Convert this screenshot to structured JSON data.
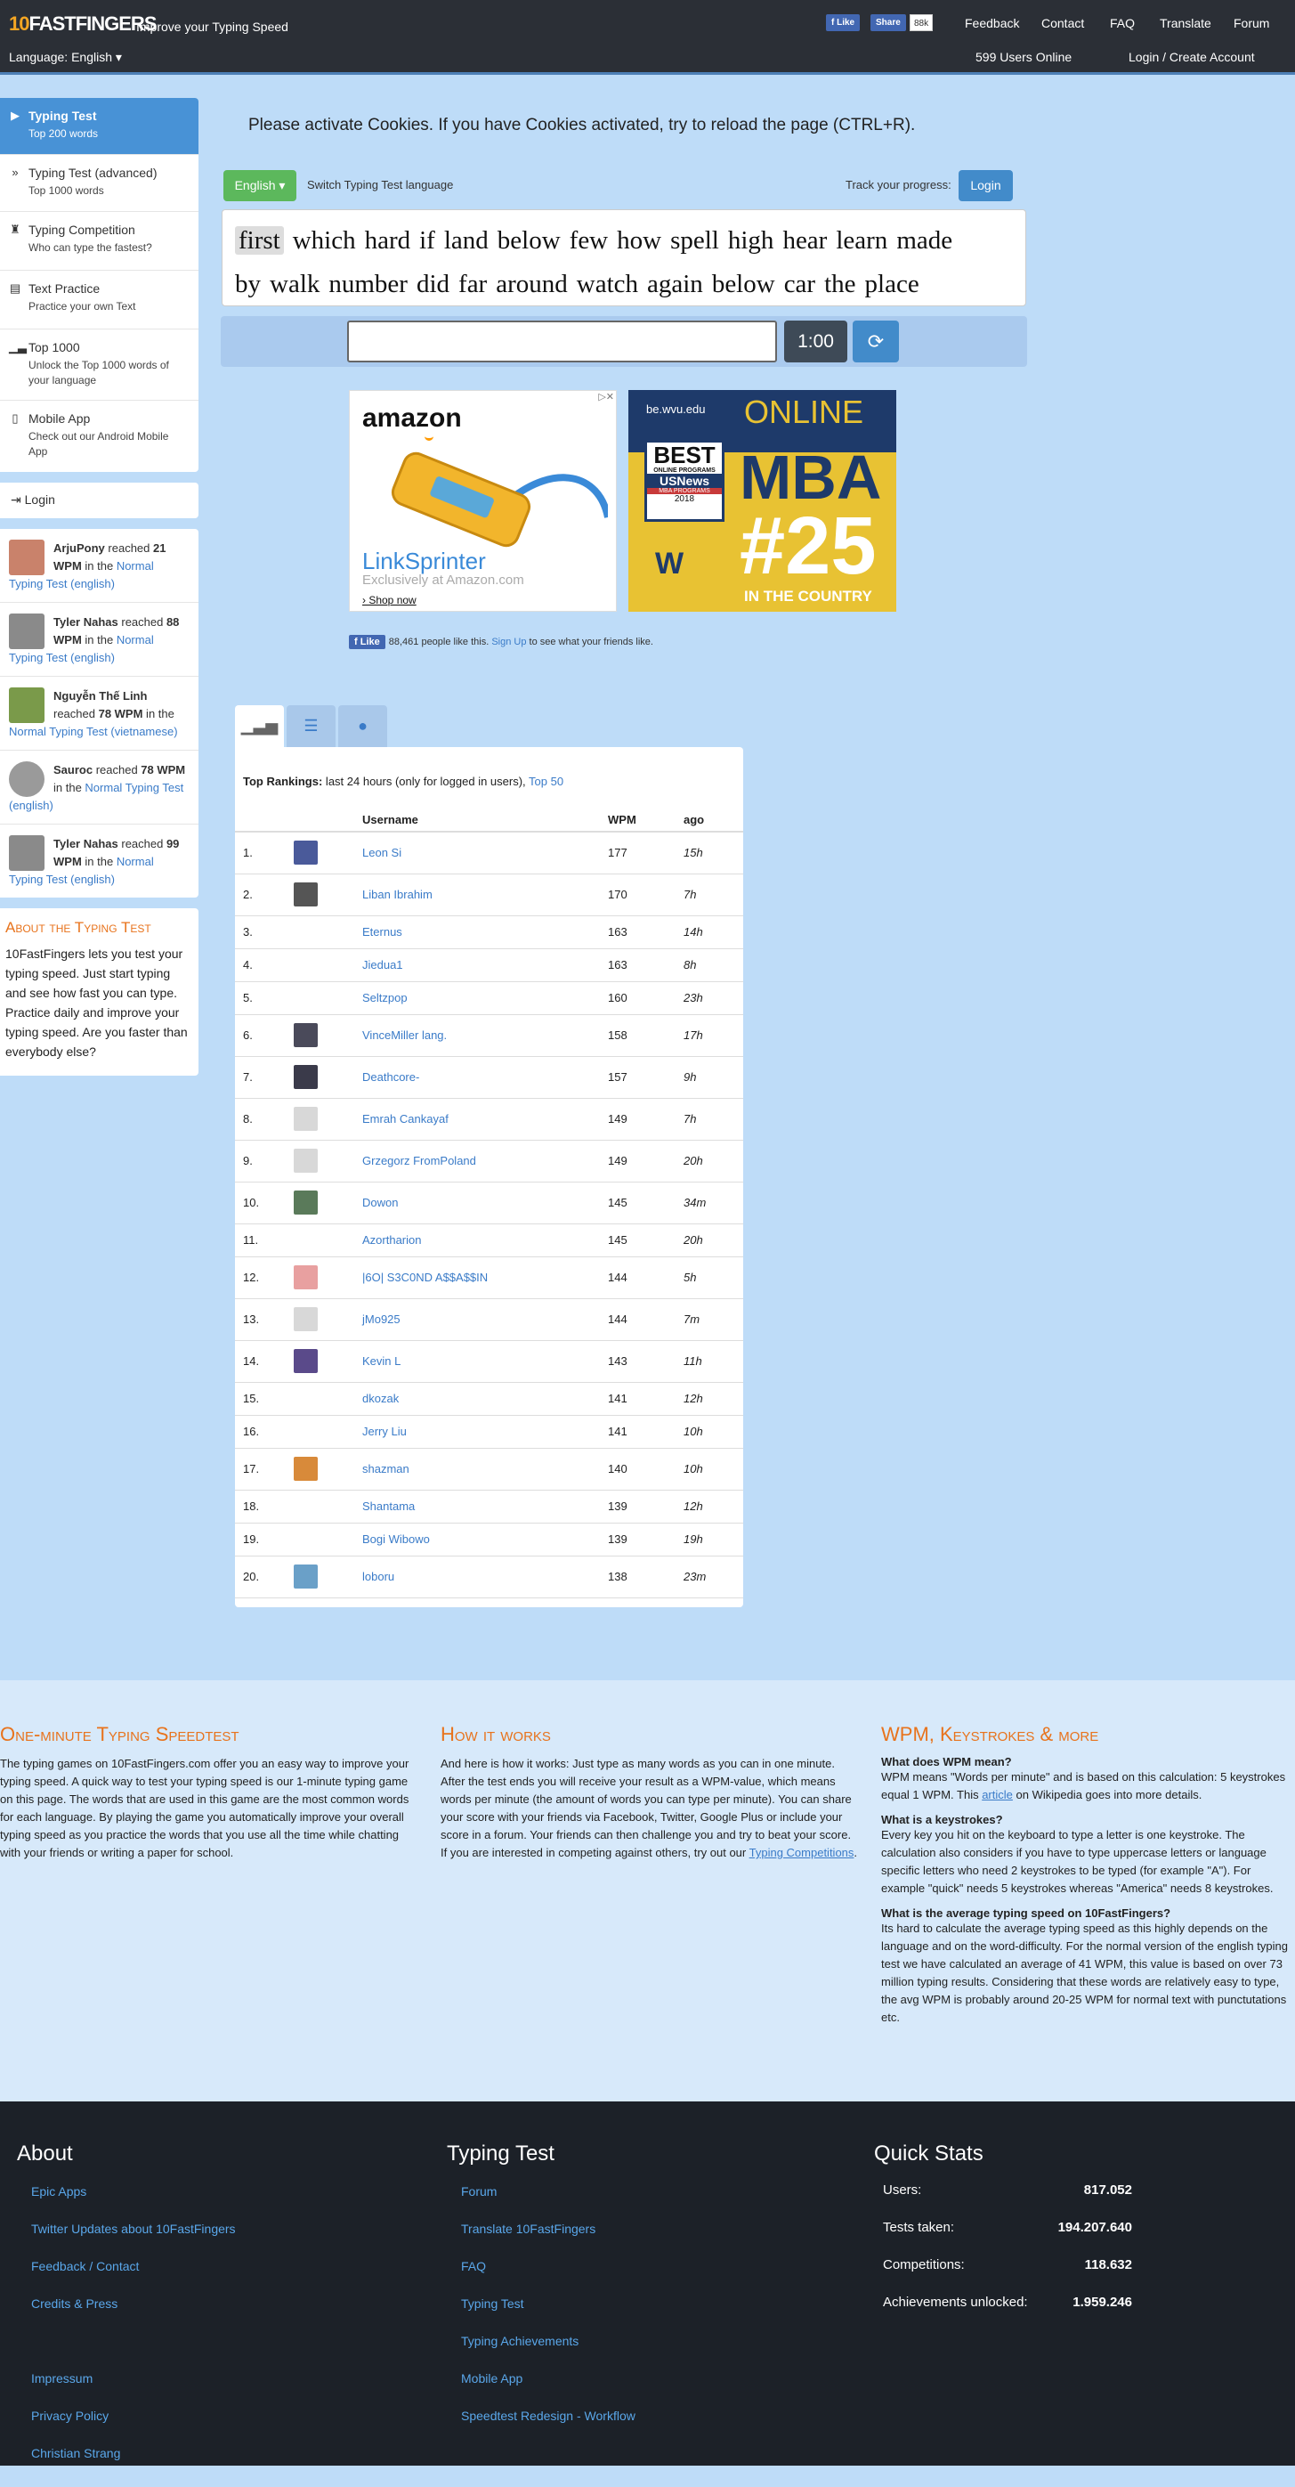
{
  "nav": {
    "logo_ten": "10",
    "logo_rest": "FASTFINGERS",
    "tagline": "Improve your Typing Speed",
    "fb_like": "Like",
    "fb_share": "Share",
    "fb_count": "88k",
    "links": [
      "Feedback",
      "Contact",
      "FAQ",
      "Translate",
      "Forum"
    ],
    "language": "Language: English",
    "online": "599 Users Online",
    "login": "Login / Create Account"
  },
  "sidebar": {
    "items": [
      {
        "title": "Typing Test",
        "sub": "Top 200 words",
        "icon": "play-icon"
      },
      {
        "title": "Typing Test (advanced)",
        "sub": "Top 1000 words",
        "icon": "fast-forward-icon"
      },
      {
        "title": "Typing Competition",
        "sub": "Who can type the fastest?",
        "icon": "trophy-icon"
      },
      {
        "title": "Text Practice",
        "sub": "Practice your own Text",
        "icon": "document-icon"
      },
      {
        "title": "Top 1000",
        "sub": "Unlock the Top 1000 words of your language",
        "icon": "signal-icon"
      },
      {
        "title": "Mobile App",
        "sub": "Check out our Android Mobile App",
        "icon": "phone-icon"
      }
    ],
    "login": "Login",
    "feed": [
      {
        "name": "ArjuPony",
        "text1": " reached ",
        "wpm": "21 WPM",
        "text2": " in the ",
        "link": "Normal Typing Test (english)",
        "avatar": "#c9826b"
      },
      {
        "name": "Tyler Nahas",
        "text1": " reached ",
        "wpm": "88 WPM",
        "text2": " in the ",
        "link": "Normal Typing Test (english)",
        "avatar": "#8a8a8a"
      },
      {
        "name": "Nguyễn Thế Linh",
        "text1": " reached ",
        "wpm": "78 WPM",
        "text2": " in the ",
        "link": "Normal Typing Test (vietnamese)",
        "avatar": "#7a9a4a"
      },
      {
        "name": "Sauroc",
        "text1": " reached ",
        "wpm": "78 WPM",
        "text2": " in the ",
        "link": "Normal Typing Test (english)",
        "avatar": "#9a9a9a"
      },
      {
        "name": "Tyler Nahas",
        "text1": " reached ",
        "wpm": "99 WPM",
        "text2": " in the ",
        "link": "Normal Typing Test (english)",
        "avatar": "#8a8a8a"
      }
    ],
    "about_title": "About the Typing Test",
    "about_text": "10FastFingers lets you test your typing speed. Just start typing and see how fast you can type. Practice daily and improve your typing speed. Are you faster than everybody else?"
  },
  "main": {
    "cookie_notice": "Please activate Cookies. If you have Cookies activated, try to reload the page (CTRL+R).",
    "lang_button": "English ▾",
    "switch_label": "Switch Typing Test language",
    "track_label": "Track your progress:",
    "login_button": "Login",
    "words_line1": [
      "first",
      "which",
      "hard",
      "if",
      "land",
      "below",
      "few",
      "how",
      "spell",
      "high",
      "hear",
      "learn",
      "made"
    ],
    "words_line2": [
      "by",
      "walk",
      "number",
      "did",
      "far",
      "around",
      "watch",
      "again",
      "below",
      "car",
      "the",
      "place"
    ],
    "timer": "1:00",
    "ad1": {
      "brand": "amazon",
      "product": "LinkSprinter",
      "sub": "Exclusively at Amazon.com",
      "cta": "› Shop now"
    },
    "ad2": {
      "domain": "be.wvu.edu",
      "headline": "ONLINE",
      "degree": "MBA",
      "best": "BEST",
      "programs": "ONLINE PROGRAMS",
      "usnews": "USNews",
      "mba_programs": "MBA PROGRAMS",
      "year": "2018",
      "rank": "#25",
      "tag": "IN THE COUNTRY"
    },
    "fb_like": "Like",
    "fb_count_text": "88,461 people like this.",
    "fb_signup": "Sign Up",
    "fb_rest": " to see what your friends like."
  },
  "rankings": {
    "header_label": "Top Rankings:",
    "header_text": " last 24 hours (only for logged in users), ",
    "top50": "Top 50",
    "columns": [
      "Username",
      "WPM",
      "ago"
    ],
    "rows": [
      {
        "rank": "1.",
        "name": "Leon Si",
        "wpm": "177",
        "ago": "15h",
        "avatar": "#4a5a9a"
      },
      {
        "rank": "2.",
        "name": "Liban Ibrahim",
        "wpm": "170",
        "ago": "7h",
        "avatar": "#555555"
      },
      {
        "rank": "3.",
        "name": "Eternus",
        "wpm": "163",
        "ago": "14h",
        "avatar": ""
      },
      {
        "rank": "4.",
        "name": "Jiedua1",
        "wpm": "163",
        "ago": "8h",
        "avatar": ""
      },
      {
        "rank": "5.",
        "name": "Seltzpop",
        "wpm": "160",
        "ago": "23h",
        "avatar": ""
      },
      {
        "rank": "6.",
        "name": "VinceMiller lang.",
        "wpm": "158",
        "ago": "17h",
        "avatar": "#4a4a5a"
      },
      {
        "rank": "7.",
        "name": "Deathcore-",
        "wpm": "157",
        "ago": "9h",
        "avatar": "#3a3a4a"
      },
      {
        "rank": "8.",
        "name": "Emrah Cankayaf",
        "wpm": "149",
        "ago": "7h",
        "avatar": "#d8d8d8"
      },
      {
        "rank": "9.",
        "name": "Grzegorz FromPoland",
        "wpm": "149",
        "ago": "20h",
        "avatar": "#d8d8d8"
      },
      {
        "rank": "10.",
        "name": "Dowon",
        "wpm": "145",
        "ago": "34m",
        "avatar": "#5a7a5a"
      },
      {
        "rank": "11.",
        "name": "Azortharion",
        "wpm": "145",
        "ago": "20h",
        "avatar": ""
      },
      {
        "rank": "12.",
        "name": "|6O| S3C0ND A$$A$$IN",
        "wpm": "144",
        "ago": "5h",
        "avatar": "#e8a0a0"
      },
      {
        "rank": "13.",
        "name": "jMo925",
        "wpm": "144",
        "ago": "7m",
        "avatar": "#d8d8d8"
      },
      {
        "rank": "14.",
        "name": "Kevin L",
        "wpm": "143",
        "ago": "11h",
        "avatar": "#5a4a8a"
      },
      {
        "rank": "15.",
        "name": "dkozak",
        "wpm": "141",
        "ago": "12h",
        "avatar": ""
      },
      {
        "rank": "16.",
        "name": "Jerry Liu",
        "wpm": "141",
        "ago": "10h",
        "avatar": ""
      },
      {
        "rank": "17.",
        "name": "shazman",
        "wpm": "140",
        "ago": "10h",
        "avatar": "#d88a3a"
      },
      {
        "rank": "18.",
        "name": "Shantama",
        "wpm": "139",
        "ago": "12h",
        "avatar": ""
      },
      {
        "rank": "19.",
        "name": "Bogi Wibowo",
        "wpm": "139",
        "ago": "19h",
        "avatar": ""
      },
      {
        "rank": "20.",
        "name": "loboru",
        "wpm": "138",
        "ago": "23m",
        "avatar": "#6aa0c8"
      }
    ]
  },
  "info": {
    "col1_title": "One-minute Typing Speedtest",
    "col1_text": "The typing games on 10FastFingers.com offer you an easy way to improve your typing speed. A quick way to test your typing speed is our 1-minute typing game on this page. The words that are used in this game are the most common words for each language. By playing the game you automatically improve your overall typing speed as you practice the words that you use all the time while chatting with your friends or writing a paper for school.",
    "col2_title": "How it works",
    "col2_text": "And here is how it works: Just type as many words as you can in one minute. After the test ends you will receive your result as a WPM-value, which means words per minute (the amount of words you can type per minute). You can share your score with your friends via Facebook, Twitter, Google Plus or include your score in a forum. Your friends can then challenge you and try to beat your score. If you are interested in competing against others, try out our ",
    "col2_link": "Typing Competitions",
    "col2_end": ".",
    "col3_title": "WPM, Keystrokes & more",
    "q1": "What does WPM mean?",
    "a1_pre": "WPM means \"Words per minute\" and is based on this calculation: 5 keystrokes equal 1 WPM. This ",
    "a1_link": "article",
    "a1_post": " on Wikipedia goes into more details.",
    "q2": "What is a keystrokes?",
    "a2": "Every key you hit on the keyboard to type a letter is one keystroke. The calculation also considers if you have to type uppercase letters or language specific letters who need 2 keystrokes to be typed (for example \"A\"). For example \"quick\" needs 5 keystrokes whereas \"America\" needs 8 keystrokes.",
    "q3": "What is the average typing speed on 10FastFingers?",
    "a3": "Its hard to calculate the average typing speed as this highly depends on the language and on the word-difficulty. For the normal version of the english typing test we have calculated an average of 41 WPM, this value is based on over 73 million typing results. Considering that these words are relatively easy to type, the avg WPM is probably around 20-25 WPM for normal text with punctutations etc."
  },
  "footer": {
    "about_title": "About",
    "about_links": [
      "Epic Apps",
      "Twitter Updates about 10FastFingers",
      "Feedback / Contact",
      "Credits & Press",
      "",
      "Impressum",
      "Privacy Policy",
      "Christian Strang"
    ],
    "test_title": "Typing Test",
    "test_links": [
      "Forum",
      "Translate 10FastFingers",
      "FAQ",
      "Typing Test",
      "Typing Achievements",
      "Mobile App",
      "Speedtest Redesign - Workflow"
    ],
    "stats_title": "Quick Stats",
    "stats": [
      {
        "label": "Users:",
        "value": "817.052"
      },
      {
        "label": "Tests taken:",
        "value": "194.207.640"
      },
      {
        "label": "Competitions:",
        "value": "118.632"
      },
      {
        "label": "Achievements unlocked:",
        "value": "1.959.246"
      }
    ]
  }
}
